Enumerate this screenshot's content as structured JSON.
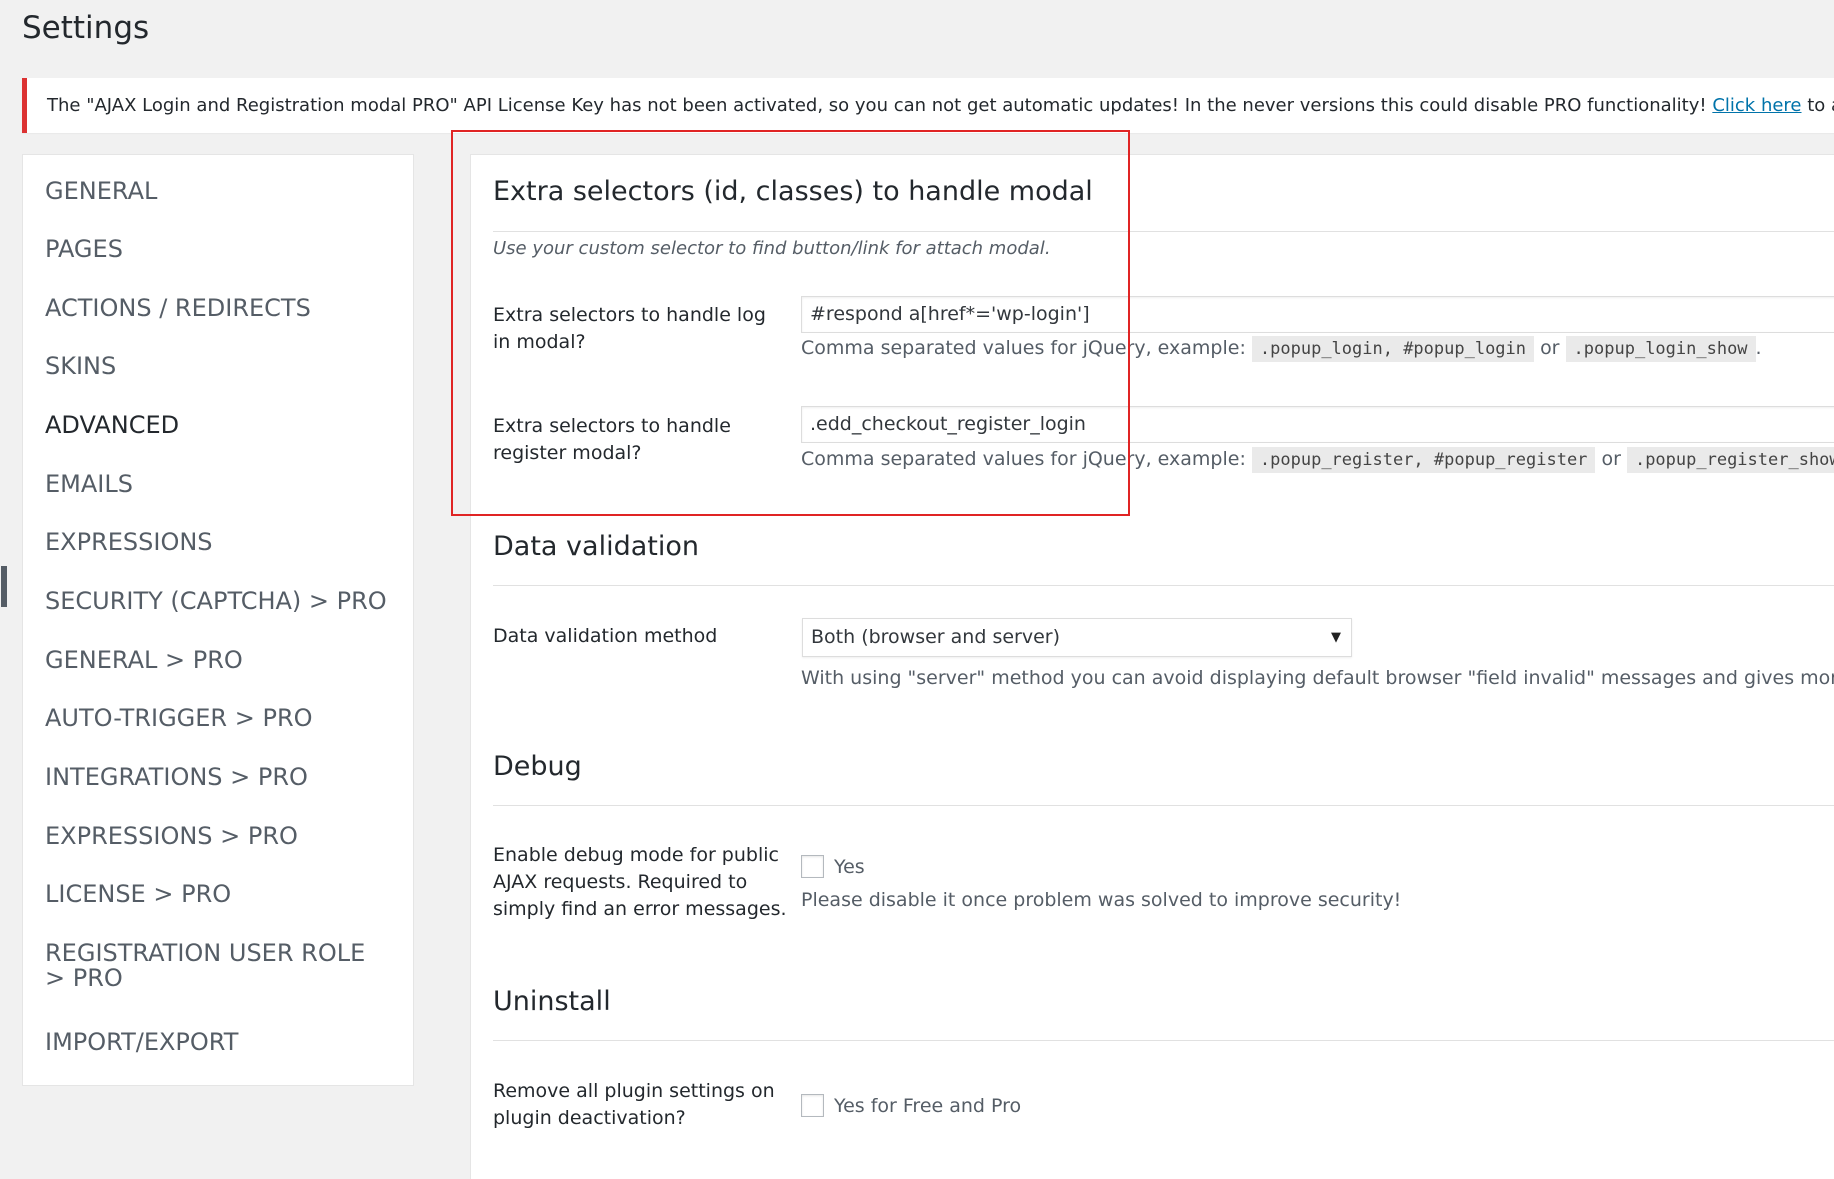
{
  "page": {
    "title": "Settings"
  },
  "notice": {
    "text_before": "The \"AJAX Login and Registration modal PRO\" API License Key has not been activated, so you can not get automatic updates! In the never versions this could disable PRO functionality! ",
    "link": "Click here",
    "text_after": " to activate the license k"
  },
  "sidebar": {
    "items": [
      {
        "label": "GENERAL"
      },
      {
        "label": "PAGES"
      },
      {
        "label": "ACTIONS / REDIRECTS"
      },
      {
        "label": "SKINS"
      },
      {
        "label": "ADVANCED",
        "active": true
      },
      {
        "label": "EMAILS"
      },
      {
        "label": "EXPRESSIONS"
      },
      {
        "label": "SECURITY (CAPTCHA) > PRO"
      },
      {
        "label": "GENERAL > PRO"
      },
      {
        "label": "AUTO-TRIGGER > PRO"
      },
      {
        "label": "INTEGRATIONS > PRO"
      },
      {
        "label": "EXPRESSIONS > PRO"
      },
      {
        "label": "LICENSE > PRO"
      },
      {
        "label": "REGISTRATION USER ROLE > PRO"
      },
      {
        "label": "IMPORT/EXPORT"
      }
    ]
  },
  "extra_selectors": {
    "title": "Extra selectors (id, classes) to handle modal",
    "description": "Use your custom selector to find button/link for attach modal.",
    "login": {
      "label": "Extra selectors to handle log in modal?",
      "value": "#respond a[href*='wp-login']",
      "help_prefix": "Comma separated values for jQuery, example:",
      "code1": ".popup_login, #popup_login",
      "or": "or",
      "code2": ".popup_login_show",
      "suffix": "."
    },
    "register": {
      "label": "Extra selectors to handle register modal?",
      "value": ".edd_checkout_register_login",
      "help_prefix": "Comma separated values for jQuery, example:",
      "code1": ".popup_register, #popup_register",
      "or": "or",
      "code2": ".popup_register_show"
    }
  },
  "data_validation": {
    "title": "Data validation",
    "method_label": "Data validation method",
    "method_value": "Both (browser and server)",
    "help": "With using \"server\" method you can avoid displaying default browser \"field invalid\" messages and gives more custom"
  },
  "debug": {
    "title": "Debug",
    "label": "Enable debug mode for public AJAX requests. Required to simply find an error messages.",
    "checkbox_label": "Yes",
    "help": "Please disable it once problem was solved to improve security!"
  },
  "uninstall": {
    "title": "Uninstall",
    "label": "Remove all plugin settings on plugin deactivation?",
    "checkbox_label": "Yes for Free and Pro"
  },
  "colors": {
    "highlight": "#e02424",
    "notice_border": "#dc3232",
    "link": "#0073aa"
  }
}
